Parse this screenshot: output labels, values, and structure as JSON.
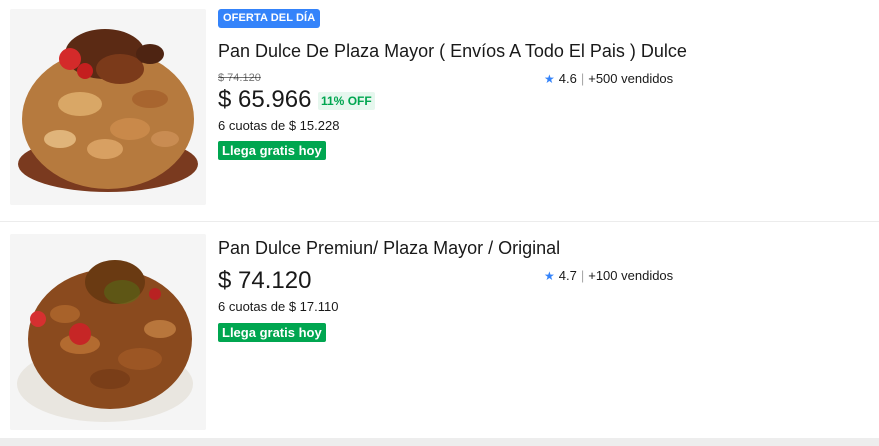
{
  "results": [
    {
      "deal_badge": "OFERTA DEL DÍA",
      "title": "Pan Dulce De Plaza Mayor ( Envíos A Todo El Pais ) Dulce",
      "old_price": "$ 74.120",
      "price": "$ 65.966",
      "discount": "11% OFF",
      "installments": "6 cuotas de $ 15.228",
      "shipping": "Llega gratis hoy",
      "rating": "4.6",
      "sold": "+500 vendidos"
    },
    {
      "title": "Pan Dulce Premiun/ Plaza Mayor / Original",
      "price": "$ 74.120",
      "installments": "6 cuotas de $ 17.110",
      "shipping": "Llega gratis hoy",
      "rating": "4.7",
      "sold": "+100 vendidos"
    }
  ],
  "colors": {
    "accent_blue": "#3483fa",
    "success_green": "#00a650",
    "discount_bg": "#e6f7ee"
  },
  "icons": {
    "rating": "star-icon"
  }
}
